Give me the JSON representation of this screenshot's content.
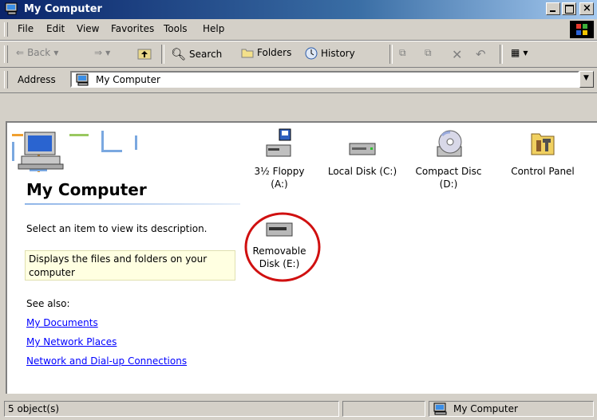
{
  "window": {
    "title": "My Computer"
  },
  "menu": {
    "items": [
      "File",
      "Edit",
      "View",
      "Favorites",
      "Tools",
      "Help"
    ]
  },
  "toolbar": {
    "back": "Back",
    "search": "Search",
    "folders": "Folders",
    "history": "History"
  },
  "address": {
    "label": "Address",
    "value": "My Computer"
  },
  "left_pane": {
    "heading": "My Computer",
    "instruction": "Select an item to view its description.",
    "description": "Displays the files and folders on your computer",
    "see_also": "See also:",
    "links": [
      "My Documents",
      "My Network Places",
      "Network and Dial-up Connections"
    ]
  },
  "drives": [
    {
      "line1": "3½ Floppy",
      "line2": "(A:)",
      "icon": "floppy-drive-icon"
    },
    {
      "line1": "Local Disk (C:)",
      "line2": "",
      "icon": "hard-disk-icon"
    },
    {
      "line1": "Compact Disc",
      "line2": "(D:)",
      "icon": "cd-drive-icon"
    },
    {
      "line1": "Control Panel",
      "line2": "",
      "icon": "control-panel-icon"
    },
    {
      "line1": "Removable",
      "line2": "Disk (E:)",
      "icon": "removable-disk-icon"
    }
  ],
  "status": {
    "objects": "5 object(s)",
    "location": "My Computer"
  },
  "colors": {
    "annotation_circle": "#d01010",
    "link": "#0000ff",
    "titlebar": "#0a246a"
  }
}
